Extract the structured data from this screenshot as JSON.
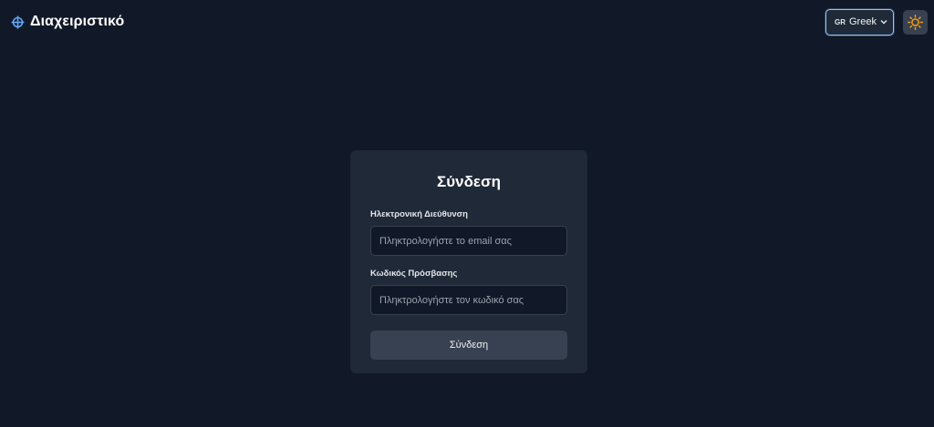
{
  "header": {
    "title": "Διαχειριστικό",
    "logo_icon": "crosshair-icon",
    "language": {
      "flag": "GR",
      "selected": "Greek",
      "icon": "chevron-down-icon"
    },
    "theme_toggle_icon": "sun-icon"
  },
  "login": {
    "title": "Σύνδεση",
    "email": {
      "label": "Ηλεκτρονική Διεύθυνση",
      "placeholder": "Πληκτρολογήστε το email σας",
      "value": ""
    },
    "password": {
      "label": "Κωδικός Πρόσβασης",
      "placeholder": "Πληκτρολογήστε τον κωδικό σας",
      "value": ""
    },
    "submit_label": "Σύνδεση"
  },
  "colors": {
    "background": "#111827",
    "card": "#1f2937",
    "accent": "#60a5fa",
    "sun": "#f59e0b"
  }
}
